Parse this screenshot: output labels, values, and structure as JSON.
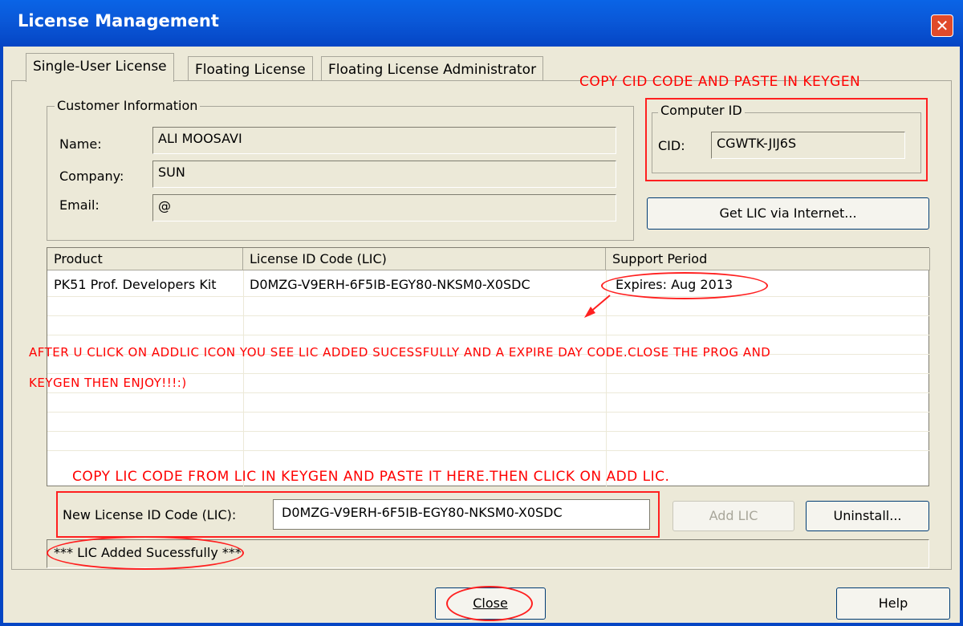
{
  "window": {
    "title": "License Management",
    "close_icon": "close-icon"
  },
  "tabs": [
    {
      "label": "Single-User License",
      "active": true
    },
    {
      "label": "Floating License",
      "active": false
    },
    {
      "label": "Floating License Administrator",
      "active": false
    }
  ],
  "customer_info": {
    "group_label": "Customer Information",
    "name_label": "Name:",
    "name_value": "ALI MOOSAVI",
    "company_label": "Company:",
    "company_value": "SUN",
    "email_label": "Email:",
    "email_value": "@"
  },
  "computer_id": {
    "group_label": "Computer ID",
    "cid_label": "CID:",
    "cid_value": "CGWTK-JIJ6S"
  },
  "get_lic_button": "Get LIC via Internet...",
  "license_table": {
    "columns": [
      "Product",
      "License ID Code (LIC)",
      "Support Period"
    ],
    "rows": [
      {
        "product": "PK51 Prof. Developers Kit",
        "lic": "D0MZG-V9ERH-6F5IB-EGY80-NKSM0-X0SDC",
        "support": "Expires: Aug 2013"
      }
    ]
  },
  "new_lic": {
    "label": "New License ID Code (LIC):",
    "value": "D0MZG-V9ERH-6F5IB-EGY80-NKSM0-X0SDC"
  },
  "buttons": {
    "add_lic": "Add LIC",
    "uninstall": "Uninstall...",
    "close": "Close",
    "help": "Help"
  },
  "status": {
    "text": "*** LIC Added Sucessfully ***"
  },
  "annotations": {
    "cid_note": "COPY CID CODE AND PASTE IN KEYGEN",
    "after_note_line1": "AFTER U CLICK ON ADDLIC ICON YOU SEE LIC ADDED SUCESSFULLY AND A EXPIRE DAY CODE.CLOSE THE PROG AND",
    "after_note_line2": "KEYGEN THEN ENJOY!!!:)",
    "lic_note": "COPY LIC CODE FROM LIC IN KEYGEN AND PASTE IT HERE.THEN CLICK ON ADD LIC.",
    "color": "#ff0000"
  },
  "colors": {
    "titlebar": "#0a58d8",
    "dialog_bg": "#ece9d8",
    "annotation": "#ff0000"
  }
}
